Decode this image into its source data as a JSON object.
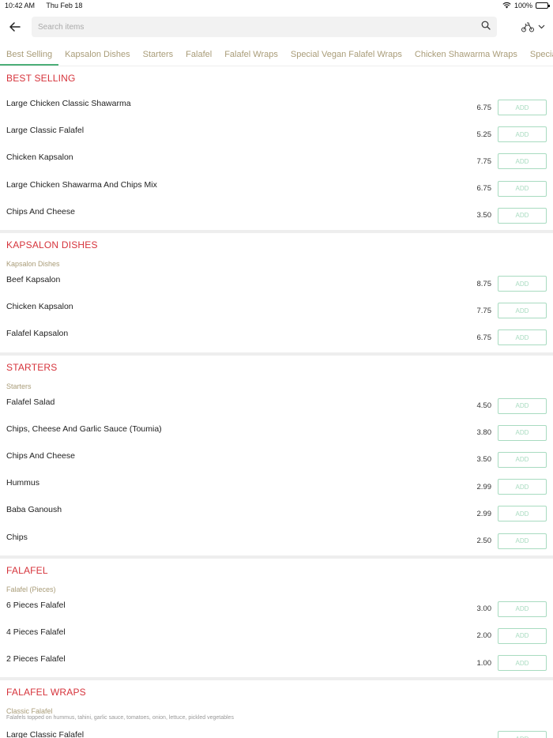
{
  "status": {
    "time": "10:42 AM",
    "date": "Thu Feb 18",
    "battery": "100%"
  },
  "search": {
    "placeholder": "Search items"
  },
  "tabs": [
    {
      "label": "Best Selling",
      "active": true
    },
    {
      "label": "Kapsalon Dishes"
    },
    {
      "label": "Starters"
    },
    {
      "label": "Falafel"
    },
    {
      "label": "Falafel Wraps"
    },
    {
      "label": "Special Vegan Falafel Wraps"
    },
    {
      "label": "Chicken Shawarma Wraps"
    },
    {
      "label": "Special O"
    }
  ],
  "add_label": "ADD",
  "sections": [
    {
      "title": "BEST SELLING",
      "items": [
        {
          "name": "Large Chicken Classic Shawarma",
          "price": "6.75"
        },
        {
          "name": "Large Classic Falafel",
          "price": "5.25"
        },
        {
          "name": "Chicken Kapsalon",
          "price": "7.75"
        },
        {
          "name": "Large Chicken Shawarma And Chips Mix",
          "price": "6.75"
        },
        {
          "name": "Chips And Cheese",
          "price": "3.50"
        }
      ]
    },
    {
      "title": "KAPSALON DISHES",
      "subcat": "Kapsalon Dishes",
      "items": [
        {
          "name": "Beef Kapsalon",
          "price": "8.75"
        },
        {
          "name": "Chicken Kapsalon",
          "price": "7.75"
        },
        {
          "name": "Falafel Kapsalon",
          "price": "6.75"
        }
      ]
    },
    {
      "title": "STARTERS",
      "subcat": "Starters",
      "items": [
        {
          "name": "Falafel Salad",
          "price": "4.50"
        },
        {
          "name": "Chips, Cheese And Garlic Sauce (Toumia)",
          "price": "3.80"
        },
        {
          "name": "Chips And Cheese",
          "price": "3.50"
        },
        {
          "name": "Hummus",
          "price": "2.99"
        },
        {
          "name": "Baba Ganoush",
          "price": "2.99"
        },
        {
          "name": "Chips",
          "price": "2.50"
        }
      ]
    },
    {
      "title": "FALAFEL",
      "subcat": "Falafel (Pieces)",
      "items": [
        {
          "name": "6 Pieces Falafel",
          "price": "3.00"
        },
        {
          "name": "4 Pieces Falafel",
          "price": "2.00"
        },
        {
          "name": "2 Pieces Falafel",
          "price": "1.00"
        }
      ]
    },
    {
      "title": "FALAFEL WRAPS",
      "subcat": "Classic Falafel",
      "subdesc": "Falafels topped on hummus, tahini, garlic sauce, tomatoes, onion, lettuce, pickled vegetables",
      "items": [
        {
          "name": "Large Classic Falafel",
          "price": ""
        }
      ]
    }
  ]
}
